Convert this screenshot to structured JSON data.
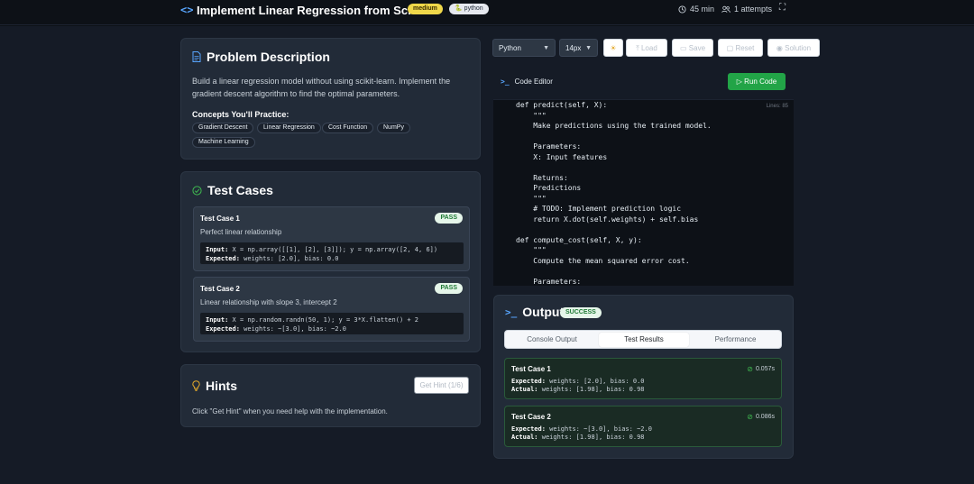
{
  "header": {
    "code_icon": "<>",
    "title": "Implement Linear Regression from Scratch",
    "difficulty": "medium",
    "language_badge": "python",
    "time": "45 min",
    "attempts": "1 attempts"
  },
  "problem": {
    "title": "Problem Description",
    "description_line1": "Build a linear regression model without using scikit-learn. Implement the",
    "description_line2": "gradient descent algorithm to find the optimal parameters.",
    "concepts_title": "Concepts You'll Practice:",
    "concepts": [
      "Gradient Descent",
      "Linear Regression",
      "Cost Function",
      "NumPy",
      "Machine Learning"
    ]
  },
  "test_cases": {
    "title": "Test Cases",
    "items": [
      {
        "name": "Test Case 1",
        "status": "PASS",
        "description": "Perfect linear relationship",
        "input_label": "Input:",
        "input": "X = np.array([[1], [2], [3]]); y = np.array([2, 4, 6])",
        "expected_label": "Expected:",
        "expected": "weights: [2.0], bias: 0.0"
      },
      {
        "name": "Test Case 2",
        "status": "PASS",
        "description": "Linear relationship with slope 3, intercept 2",
        "input_label": "Input:",
        "input": "X = np.random.randn(50, 1); y = 3*X.flatten() + 2",
        "expected_label": "Expected:",
        "expected": "weights: ~[3.0], bias: ~2.0"
      }
    ]
  },
  "hints": {
    "title": "Hints",
    "button": "Get Hint (1/6)",
    "text": "Click \"Get Hint\" when you need help with the implementation."
  },
  "toolbar": {
    "language": "Python",
    "font_size": "14px",
    "theme_icon": "☀",
    "load": "Load",
    "save": "Save",
    "reset": "Reset",
    "solution": "Solution"
  },
  "editor": {
    "label": "Code Editor",
    "run_button": "Run Code",
    "lines": "Lines: 85",
    "code": "def predict(self, X):\n    \"\"\"\n    Make predictions using the trained model.\n\n    Parameters:\n    X: Input features\n\n    Returns:\n    Predictions\n    \"\"\"\n    # TODO: Implement prediction logic\n    return X.dot(self.weights) + self.bias\n\ndef compute_cost(self, X, y):\n    \"\"\"\n    Compute the mean squared error cost.\n\n    Parameters:\n    X: F"
  },
  "output": {
    "title": "Output",
    "status": "SUCCESS",
    "tabs": [
      "Console Output",
      "Test Results",
      "Performance"
    ],
    "results": [
      {
        "name": "Test Case 1",
        "time": "0.057s",
        "expected_label": "Expected:",
        "expected": "weights: [2.0], bias: 0.0",
        "actual_label": "Actual:",
        "actual": "weights: [1.98], bias: 0.98"
      },
      {
        "name": "Test Case 2",
        "time": "0.086s",
        "expected_label": "Expected:",
        "expected": "weights: ~[3.0], bias: ~2.0",
        "actual_label": "Actual:",
        "actual": "weights: [1.98], bias: 0.98"
      }
    ]
  },
  "colors": {
    "run_button": "#22a447",
    "accent": "#58a6ff",
    "pass": "#1f7a35",
    "difficulty": "#f0d84a"
  }
}
